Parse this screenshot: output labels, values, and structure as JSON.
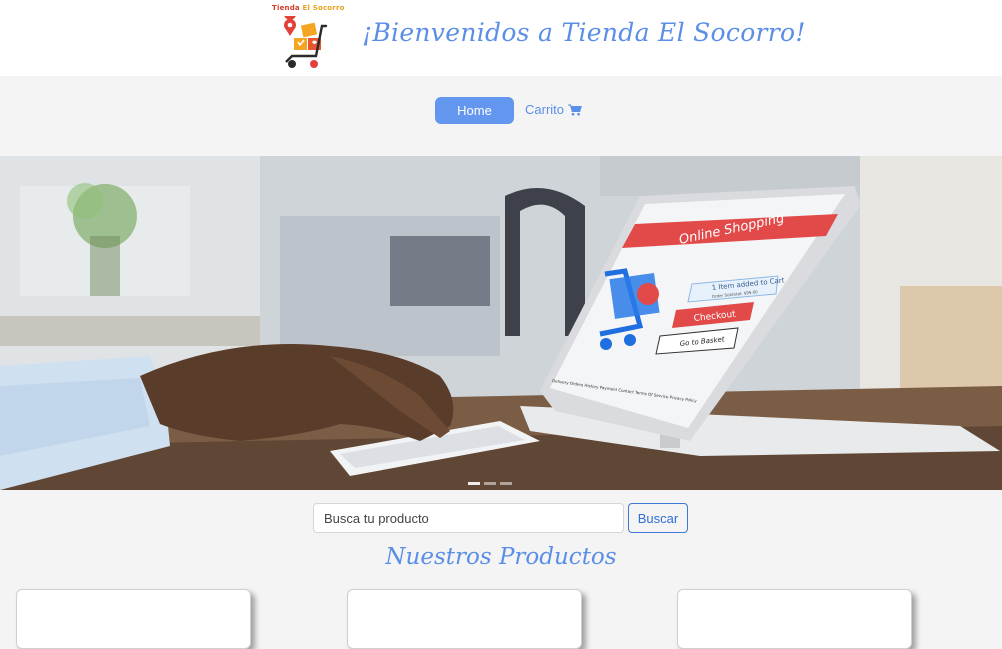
{
  "header": {
    "logo_text_part1": "Tienda",
    "logo_text_part2": "El Socorro",
    "title": "¡Bienvenidos a Tienda El Socorro!"
  },
  "nav": {
    "home_label": "Home",
    "cart_label": "Carrito",
    "cart_icon": "shopping-cart-icon"
  },
  "hero": {
    "screen_title": "Online Shopping",
    "cart_notice": "1 Item added to Cart",
    "cart_subnotice": "Order Subtotal: $99.00",
    "checkout_label": "Checkout",
    "basket_label": "Go to Basket",
    "footer_links": [
      "Delivery Orders",
      "History",
      "Payment",
      "Contact",
      "Terms Of Service",
      "Privacy Policy"
    ]
  },
  "search": {
    "placeholder": "Busca tu producto",
    "button_label": "Buscar"
  },
  "products": {
    "title": "Nuestros Productos"
  },
  "colors": {
    "accent": "#5b8ee6",
    "button": "#6396ef",
    "background": "#f4f4f4"
  }
}
